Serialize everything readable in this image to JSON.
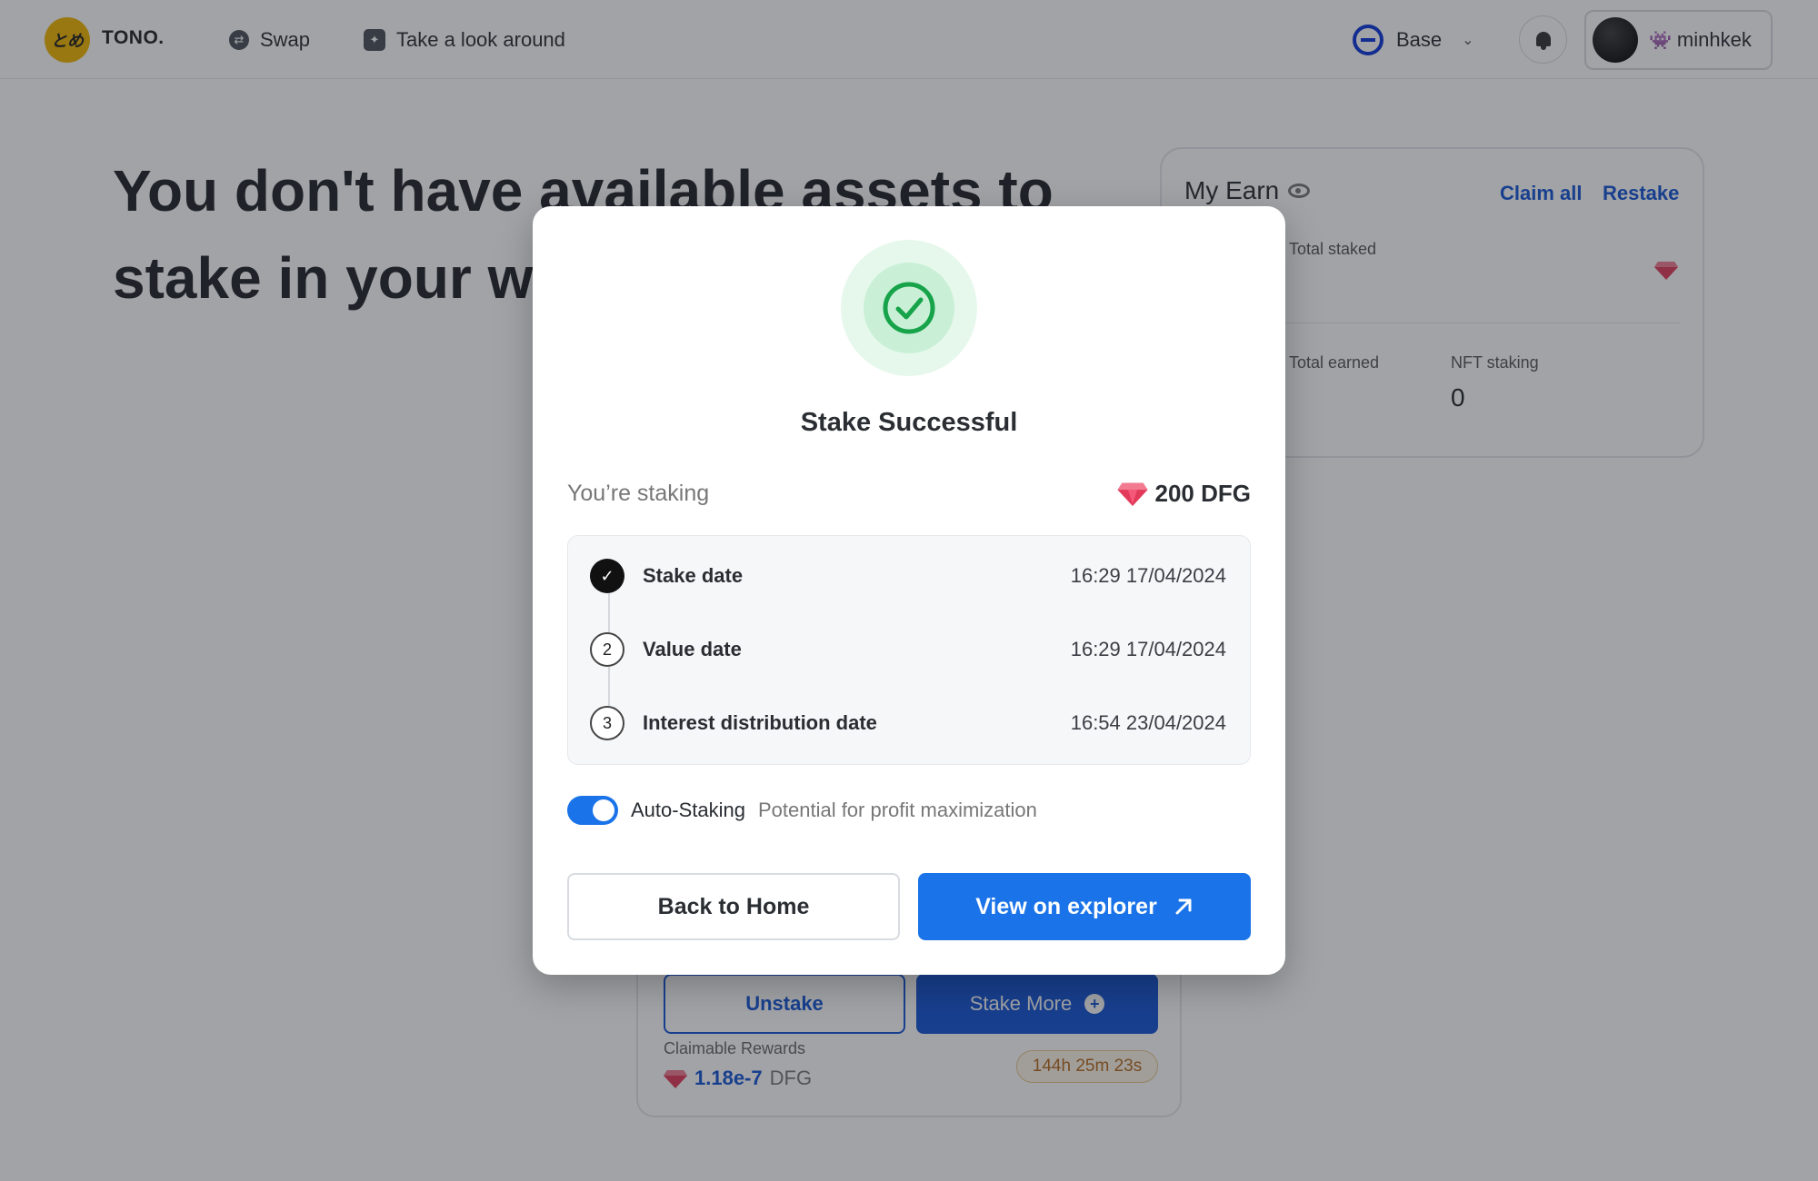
{
  "header": {
    "brand": "TONO.",
    "logo_text": "とめ",
    "nav": [
      {
        "label": "Swap",
        "icon": "swap-icon"
      },
      {
        "label": "Take a look around",
        "icon": "sparkle-icon"
      }
    ],
    "network": {
      "label": "Base",
      "icon": "base-network-icon"
    },
    "user": {
      "name": "minhkek",
      "emoji": "👾"
    }
  },
  "page": {
    "hero": "You don't have available assets to stake in your wallet",
    "my_earn": {
      "title": "My Earn",
      "claim_all": "Claim all",
      "restake": "Restake",
      "staked_label": "Total staked",
      "earned_label": "Total earned",
      "nft_label": "NFT staking",
      "nft_value": "0"
    },
    "position": {
      "unstake": "Unstake",
      "stake_more": "Stake More",
      "rewards_label": "Claimable Rewards",
      "rewards_value": "1.18e-7",
      "rewards_unit": "DFG",
      "timer": "144h 25m 23s"
    }
  },
  "modal": {
    "title": "Stake Successful",
    "staking_label": "You’re staking",
    "staking_amount": "200 DFG",
    "timeline": [
      {
        "marker": "✓",
        "label": "Stake date",
        "date": "16:29 17/04/2024"
      },
      {
        "marker": "2",
        "label": "Value date",
        "date": "16:29 17/04/2024"
      },
      {
        "marker": "3",
        "label": "Interest distribution date",
        "date": "16:54 23/04/2024"
      }
    ],
    "auto_staking": {
      "label": "Auto-Staking",
      "description": "Potential for profit maximization",
      "enabled": true
    },
    "back_home": "Back to Home",
    "view_explorer": "View on explorer"
  },
  "colors": {
    "accent": "#1a73e8",
    "success": "#16a34a",
    "gem": "#e23a5a"
  }
}
